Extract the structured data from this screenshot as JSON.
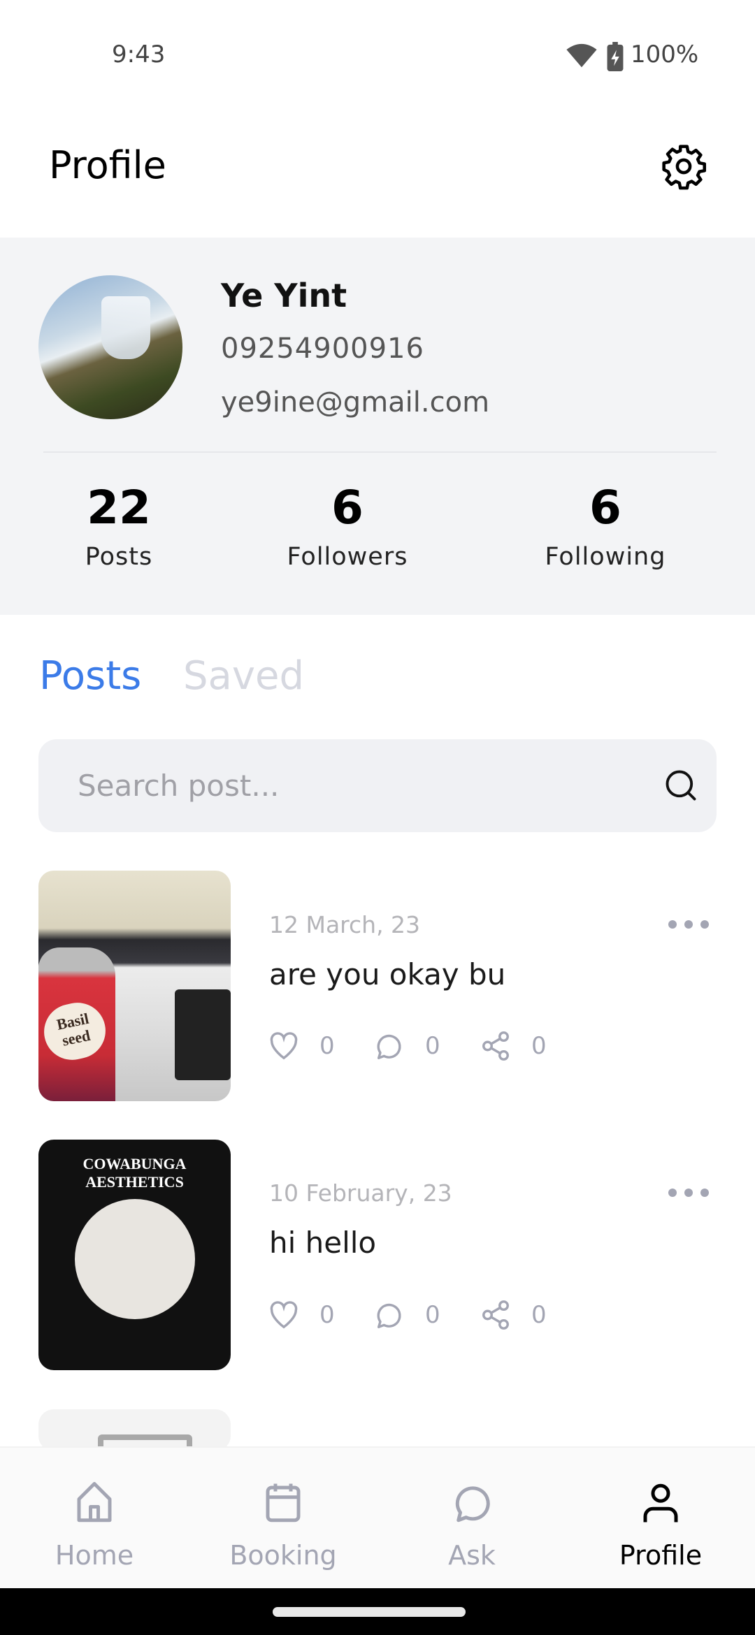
{
  "status_bar": {
    "time": "9:43",
    "battery": "100%",
    "icons": [
      "wifi-icon",
      "battery-charging-icon"
    ]
  },
  "header": {
    "title": "Profile",
    "settings_icon": "gear-icon"
  },
  "profile": {
    "name": "Ye Yint",
    "phone": "09254900916",
    "email": "ye9ine@gmail.com",
    "stats": [
      {
        "value": "22",
        "label": "Posts"
      },
      {
        "value": "6",
        "label": "Followers"
      },
      {
        "value": "6",
        "label": "Following"
      }
    ]
  },
  "tabs": [
    {
      "label": "Posts",
      "active": true
    },
    {
      "label": "Saved",
      "active": false
    }
  ],
  "colors": {
    "accent": "#3b7be8",
    "inactive_tab": "#d6d8e0",
    "icon_gray": "#a3a5b3"
  },
  "search": {
    "placeholder": "Search post..."
  },
  "posts": [
    {
      "date": "12 March, 23",
      "title": "are you okay bu",
      "likes": "0",
      "comments": "0",
      "shares": "0",
      "image_text": "Basil seed"
    },
    {
      "date": "10 February, 23",
      "title": "hi hello",
      "likes": "0",
      "comments": "0",
      "shares": "0",
      "image_text": "COWABUNGA AESTHETICS"
    }
  ],
  "nav": [
    {
      "label": "Home",
      "icon": "home-icon"
    },
    {
      "label": "Booking",
      "icon": "calendar-icon"
    },
    {
      "label": "Ask",
      "icon": "chat-bubble-icon"
    },
    {
      "label": "Profile",
      "icon": "person-icon",
      "active": true
    }
  ]
}
